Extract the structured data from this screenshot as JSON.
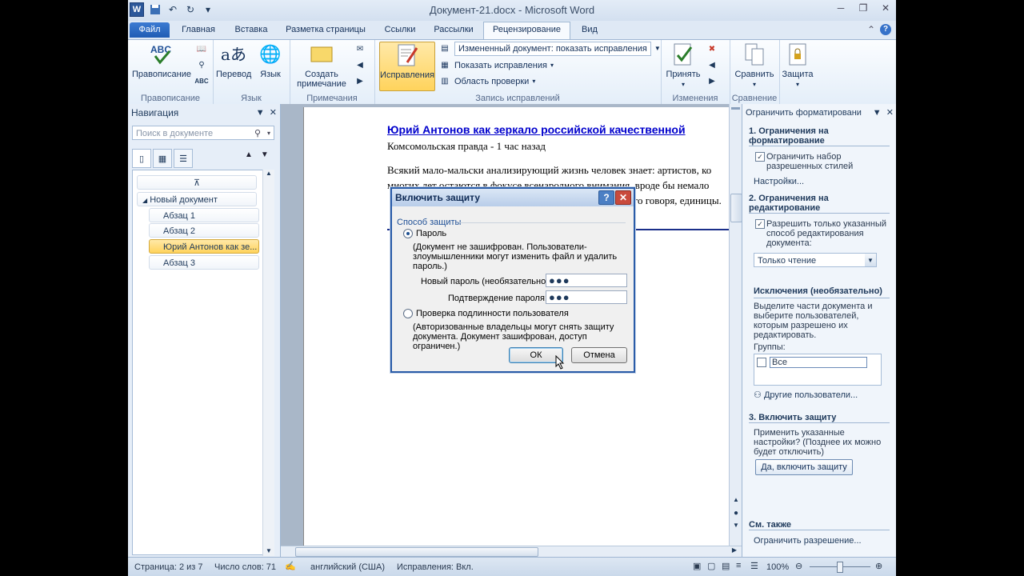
{
  "window": {
    "title": "Документ-21.docx - Microsoft Word",
    "logo": "W"
  },
  "tabs": [
    "Файл",
    "Главная",
    "Вставка",
    "Разметка страницы",
    "Ссылки",
    "Рассылки",
    "Рецензирование",
    "Вид"
  ],
  "ribbon": {
    "spelling": "Правописание",
    "translate": "Перевод",
    "language": "Язык",
    "new_comment_1": "Создать",
    "new_comment_2": "примечание",
    "track_changes": "Исправления",
    "display_combo": "Измененный документ: показать исправления",
    "show_markup": "Показать исправления",
    "reviewing_pane": "Область проверки",
    "accept": "Принять",
    "compare": "Сравнить",
    "protect": "Защита",
    "groups": {
      "proofing": "Правописание",
      "language": "Язык",
      "comments": "Примечания",
      "tracking": "Запись исправлений",
      "changes": "Изменения",
      "compare": "Сравнение"
    },
    "abc": "ABC"
  },
  "nav": {
    "title": "Навигация",
    "search_placeholder": "Поиск в документе",
    "items": [
      "Новый документ",
      "Абзац 1",
      "Абзац 2",
      "Юрий Антонов как зе...",
      "Абзац 3"
    ]
  },
  "document": {
    "heading": "Юрий Антонов как зеркало российской качественной",
    "source": "Комсомольская правда - 1 час назад",
    "line1": "Всякий мало-мальски анализирующий жизнь человек знает: артистов, ко",
    "line2": "многих лет остаются в фокусе всенародного внимания, вроде бы немало",
    "line3": "го говоря, единицы."
  },
  "restrict": {
    "title": "Ограничить форматировани",
    "s1": "1. Ограничения на форматирование",
    "s1_check": "Ограничить набор разрешенных стилей",
    "settings": "Настройки...",
    "s2": "2. Ограничения на редактирование",
    "s2_check": "Разрешить только указанный способ редактирования документа:",
    "mode": "Только чтение",
    "exceptions": "Исключения (необязательно)",
    "exceptions_text": "Выделите части документа и выберите пользователей, которым разрешено их редактировать.",
    "groups_label": "Группы:",
    "group_all": "Все",
    "other_users": "Другие пользователи...",
    "s3": "3. Включить защиту",
    "s3_text": "Применить указанные настройки? (Позднее их можно будет отключить)",
    "enable_btn": "Да, включить защиту",
    "see_also": "См. также",
    "restrict_link": "Ограничить разрешение..."
  },
  "dialog": {
    "title": "Включить защиту",
    "method_label": "Способ защиты",
    "opt_password": "Пароль",
    "password_desc": "(Документ не зашифрован. Пользователи-злоумышленники могут изменить файл и удалить пароль.)",
    "new_pwd_label": "Новый пароль (необязательно):",
    "confirm_label": "Подтверждение пароля:",
    "new_pwd_value": "●●●",
    "confirm_value": "●●●",
    "opt_auth": "Проверка подлинности пользователя",
    "auth_desc": "(Авторизованные владельцы могут снять защиту документа. Документ зашифрован, доступ ограничен.)",
    "ok": "ОК",
    "cancel": "Отмена"
  },
  "status": {
    "page": "Страница: 2 из 7",
    "words": "Число слов: 71",
    "lang": "английский (США)",
    "track": "Исправления: Вкл.",
    "zoom": "100%"
  },
  "colors": {
    "accent": "#2b579a",
    "selection": "#ffd35c",
    "dialog_border": "#2a5ca8"
  }
}
